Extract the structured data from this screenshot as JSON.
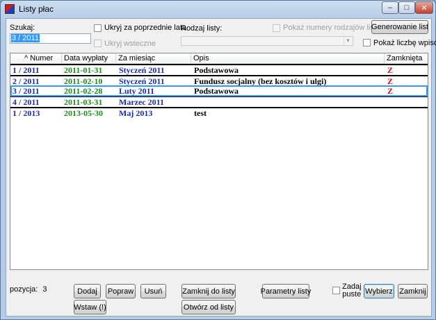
{
  "window": {
    "title": "Listy płac",
    "minimize": "–",
    "maximize": "□",
    "close": "✕"
  },
  "filters": {
    "search_label": "Szukaj:",
    "search_value": "3 / 2011",
    "hide_previous_years": "Ukryj za poprzednie lata",
    "hide_backdated": "Ukryj wsteczne",
    "list_type_label": "Rodzaj listy:",
    "list_type_value": "",
    "show_type_numbers": "Pokaż numery rodzajów list",
    "generate_button": "Generowanie list",
    "show_count": "Pokaż liczbę wpisów"
  },
  "table": {
    "columns": {
      "number": "^ Numer",
      "pay_date": "Data wypłaty",
      "for_month": "Za miesiąc",
      "description": "Opis",
      "closed": "Zamknięta"
    },
    "rows": [
      {
        "number": "1 / 2011",
        "pay_date": "2011-01-31",
        "for_month": "Styczeń 2011",
        "description": "Podstawowa",
        "closed": "Z"
      },
      {
        "number": "2 / 2011",
        "pay_date": "2011-02-10",
        "for_month": "Styczeń 2011",
        "description": "Fundusz socjalny (bez kosztów i ulgi)",
        "closed": "Z"
      },
      {
        "number": "3 / 2011",
        "pay_date": "2011-02-28",
        "for_month": "Luty 2011",
        "description": "Podstawowa",
        "closed": "Z"
      },
      {
        "number": "4 / 2011",
        "pay_date": "2011-03-31",
        "for_month": "Marzec 2011",
        "description": "",
        "closed": ""
      },
      {
        "number": "1 / 2013",
        "pay_date": "2013-05-30",
        "for_month": "Maj 2013",
        "description": "test",
        "closed": ""
      }
    ],
    "selected_row": 2
  },
  "footer": {
    "position_label": "pozycja:",
    "position_value": "3",
    "add": "Dodaj",
    "edit": "Popraw",
    "delete": "Usuń",
    "insert": "Wstaw (!)",
    "close_to_list": "Zamknij do listy",
    "open_from_list": "Otwórz od listy",
    "list_params": "Parametry listy",
    "ask_empty": "Zadaj\npuste",
    "choose": "Wybierz",
    "close": "Zamknij"
  },
  "colors": {
    "number_text": "#1a2bb0",
    "date_text": "#1a8a1a",
    "month_text": "#1a2bb0",
    "closed_mark": "#d01010",
    "selection_border": "#3399ff"
  }
}
